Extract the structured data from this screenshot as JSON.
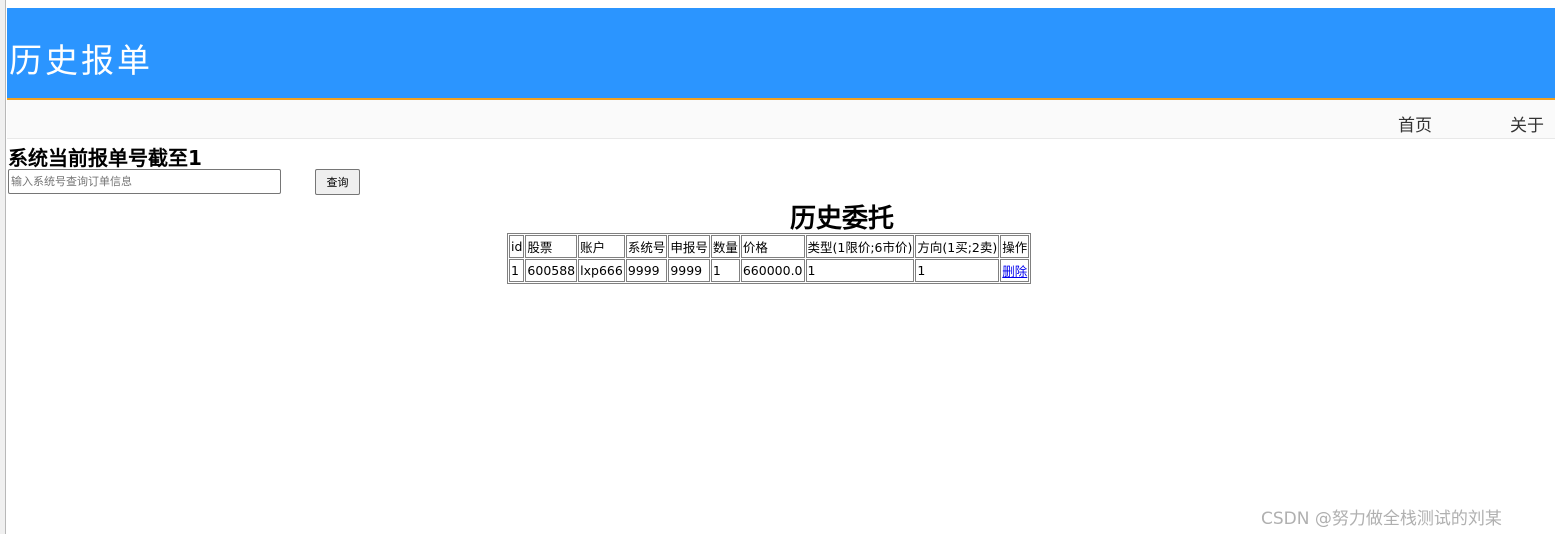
{
  "header": {
    "title": "历史报单"
  },
  "nav": {
    "home": "首页",
    "about": "关于"
  },
  "status": {
    "text": "系统当前报单号截至1"
  },
  "search": {
    "placeholder": "输入系统号查询订单信息",
    "value": "",
    "button_label": "查询"
  },
  "section": {
    "title": "历史委托"
  },
  "table": {
    "headers": [
      "id",
      "股票",
      "账户",
      "系统号",
      "申报号",
      "数量",
      "价格",
      "类型(1限价;6市价)",
      "方向(1买;2卖)",
      "操作"
    ],
    "rows": [
      {
        "id": "1",
        "stock": "600588",
        "account": "lxp666",
        "system_no": "9999",
        "declare_no": "9999",
        "quantity": "1",
        "price": "660000.0",
        "type": "1",
        "direction": "1",
        "action": "删除"
      }
    ]
  },
  "watermark": "CSDN @努力做全栈测试的刘某",
  "colors": {
    "header_bg": "#2b95ff",
    "header_border": "#f0a020",
    "link": "#0000ee"
  }
}
